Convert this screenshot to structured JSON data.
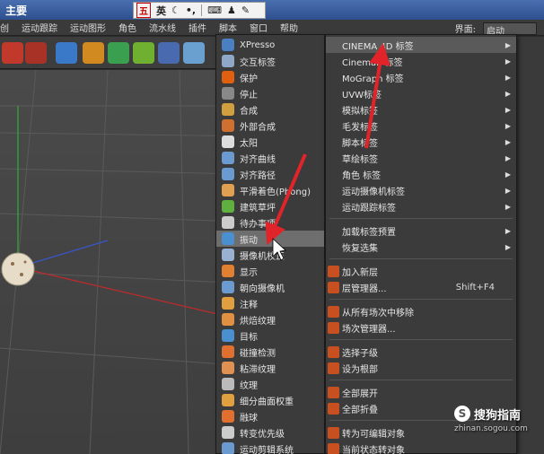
{
  "titlebar": {
    "title": "主要"
  },
  "ime": {
    "badge": "五",
    "mode": "英"
  },
  "menubar": {
    "items": [
      "创",
      "运动跟踪",
      "运动图形",
      "角色",
      "流水线",
      "插件",
      "脚本",
      "窗口",
      "帮助"
    ],
    "layout_label": "界面:",
    "layout_value": "启动"
  },
  "left_menu": {
    "items": [
      {
        "label": "XPresso",
        "icon": "xpresso-icon",
        "color": "#4a7fc1"
      },
      {
        "label": "交互标签",
        "icon": "interaction-tag-icon",
        "color": "#8fa8c8"
      },
      {
        "label": "保护",
        "icon": "protection-icon",
        "color": "#e06010"
      },
      {
        "label": "停止",
        "icon": "stop-icon",
        "color": "#888888"
      },
      {
        "label": "合成",
        "icon": "compositing-icon",
        "color": "#d0a040"
      },
      {
        "label": "外部合成",
        "icon": "external-compositing-icon",
        "color": "#d07030"
      },
      {
        "label": "太阳",
        "icon": "sun-icon",
        "color": "#dddddd"
      },
      {
        "label": "对齐曲线",
        "icon": "align-spline-icon",
        "color": "#6a9ad0"
      },
      {
        "label": "对齐路径",
        "icon": "align-path-icon",
        "color": "#6a9ad0"
      },
      {
        "label": "平滑着色(Phong)",
        "icon": "phong-icon",
        "color": "#e0a050"
      },
      {
        "label": "建筑草坪",
        "icon": "grass-icon",
        "color": "#60b040"
      },
      {
        "label": "待办事项",
        "icon": "todo-icon",
        "color": "#cccccc"
      },
      {
        "label": "振动",
        "icon": "vibrate-icon",
        "color": "#4a8fd0"
      },
      {
        "label": "摄像机校正",
        "icon": "camera-calibrate-icon",
        "color": "#9ab0d0"
      },
      {
        "label": "显示",
        "icon": "display-icon",
        "color": "#e08030"
      },
      {
        "label": "朝向摄像机",
        "icon": "look-at-camera-icon",
        "color": "#6a9ad0"
      },
      {
        "label": "注释",
        "icon": "annotation-icon",
        "color": "#e0a040"
      },
      {
        "label": "烘焙纹理",
        "icon": "bake-texture-icon",
        "color": "#e09040"
      },
      {
        "label": "目标",
        "icon": "target-icon",
        "color": "#4a8fd0"
      },
      {
        "label": "碰撞检测",
        "icon": "collision-icon",
        "color": "#e07030"
      },
      {
        "label": "粘滞纹理",
        "icon": "sticky-texture-icon",
        "color": "#e09050"
      },
      {
        "label": "纹理",
        "icon": "texture-icon",
        "color": "#bbbbbb"
      },
      {
        "label": "细分曲面权重",
        "icon": "subdivision-weight-icon",
        "color": "#e0a040"
      },
      {
        "label": "融球",
        "icon": "metaball-icon",
        "color": "#e07030"
      },
      {
        "label": "转变优先级",
        "icon": "priority-icon",
        "color": "#cccccc"
      },
      {
        "label": "运动剪辑系统",
        "icon": "motion-clip-icon",
        "color": "#6a9ad0"
      }
    ]
  },
  "right_menu": {
    "groups": [
      {
        "label": "CINEMA 4D 标签",
        "submenu": true,
        "highlight": true
      },
      {
        "label": "Cineman 标签",
        "submenu": true
      },
      {
        "label": "MoGraph 标签",
        "submenu": true
      },
      {
        "label": "UVW标签",
        "submenu": true
      },
      {
        "label": "模拟标签",
        "submenu": true
      },
      {
        "label": "毛发标签",
        "submenu": true
      },
      {
        "label": "脚本标签",
        "submenu": true
      },
      {
        "label": "草绘标签",
        "submenu": true
      },
      {
        "label": "角色 标签",
        "submenu": true
      },
      {
        "label": "运动摄像机标签",
        "submenu": true
      },
      {
        "label": "运动跟踪标签",
        "submenu": true
      }
    ],
    "presets": [
      {
        "label": "加载标签预置",
        "submenu": true
      },
      {
        "label": "恢复选集",
        "submenu": true
      }
    ],
    "actions": [
      {
        "label": "加入新层",
        "icon": "new-layer-icon"
      },
      {
        "label": "层管理器...",
        "icon": "layer-manager-icon",
        "shortcut": "Shift+F4"
      },
      {
        "label": "从所有场次中移除",
        "icon": "remove-takes-icon"
      },
      {
        "label": "场次管理器...",
        "icon": "take-manager-icon"
      },
      {
        "label": "选择子级",
        "icon": "select-children-icon"
      },
      {
        "label": "设为根部",
        "icon": "set-root-icon"
      },
      {
        "label": "全部展开",
        "icon": "expand-all-icon"
      },
      {
        "label": "全部折叠",
        "icon": "collapse-all-icon"
      },
      {
        "label": "转为可编辑对象",
        "icon": "make-editable-icon"
      },
      {
        "label": "当前状态转对象",
        "icon": "current-state-icon"
      }
    ]
  },
  "watermark": {
    "title": "搜狗指南",
    "url": "zhinan.sogou.com",
    "logo": "S"
  },
  "colors": {
    "arrow": "#e0242a",
    "highlight": "#6e6e6e"
  }
}
